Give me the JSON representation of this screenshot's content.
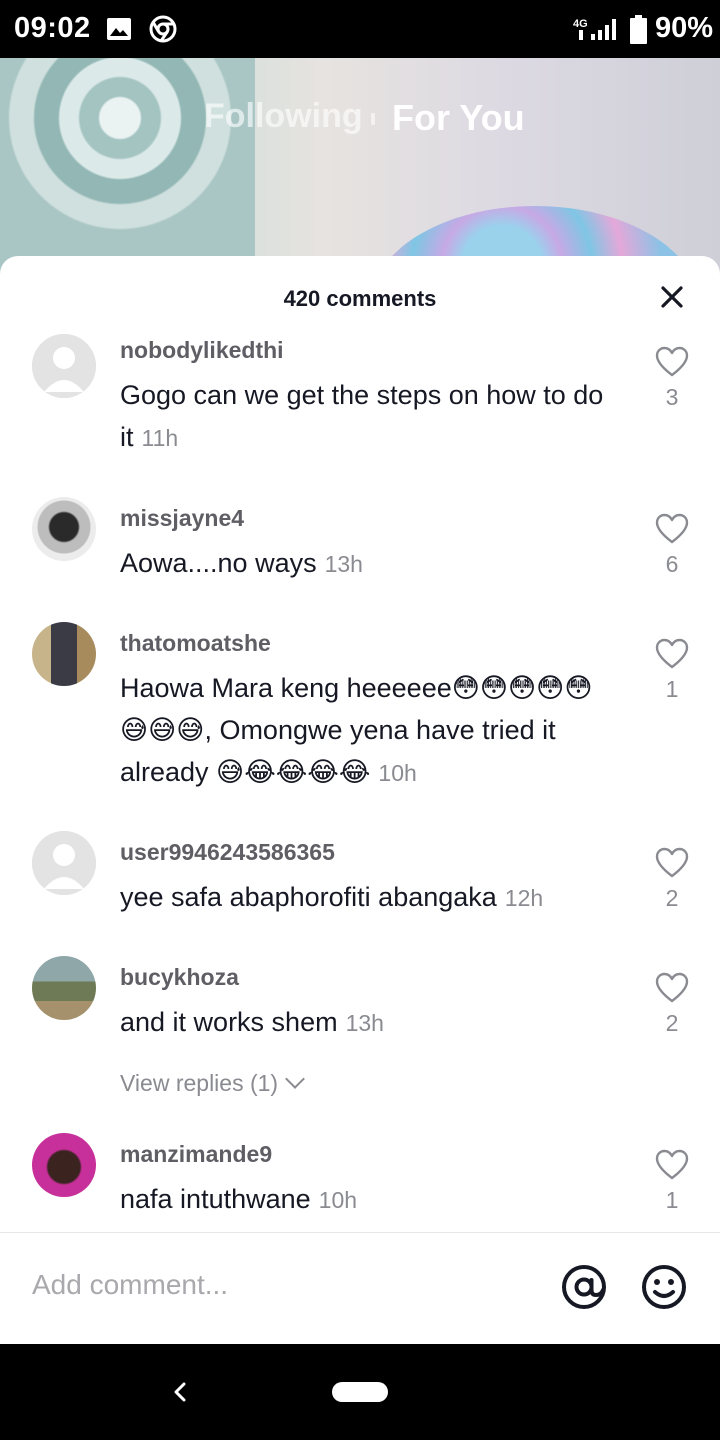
{
  "status_bar": {
    "time": "09:02",
    "battery": "90%",
    "network": "4G"
  },
  "video": {
    "tabs": {
      "following": "Following",
      "for_you": "For You"
    }
  },
  "sheet": {
    "title": "420 comments",
    "comments": [
      {
        "username": "nobodylikedthi",
        "text": "Gogo can we get the steps on how to do it",
        "time": "11h",
        "likes": "3"
      },
      {
        "username": "missjayne4",
        "text": "Aowa....no ways",
        "time": "13h",
        "likes": "6"
      },
      {
        "username": "thatomoatshe",
        "text": "Haowa Mara keng heeeeee😳😳😳😳😳😅😅😅, Omongwe yena have tried it already 😅😂😂😂😂",
        "time": "10h",
        "likes": "1"
      },
      {
        "username": "user9946243586365",
        "text": "yee safa abaphorofiti abangaka",
        "time": "12h",
        "likes": "2"
      },
      {
        "username": "bucykhoza",
        "text": "and it works shem",
        "time": "13h",
        "likes": "2",
        "view_replies": "View replies (1)"
      },
      {
        "username": "manzimande9",
        "text": "nafa intuthwane",
        "time": "10h",
        "likes": "1"
      }
    ]
  },
  "composer": {
    "placeholder": "Add comment..."
  },
  "colors": {
    "text": "#161823",
    "muted": "#8a8b91",
    "username": "#5e5e64"
  }
}
